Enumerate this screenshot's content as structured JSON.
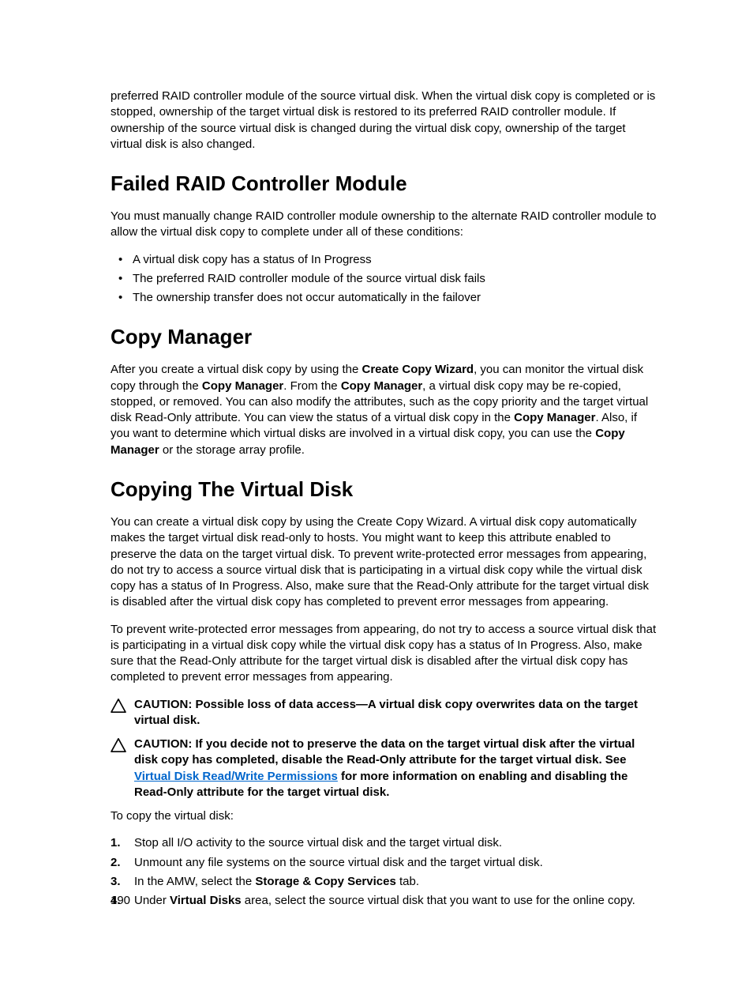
{
  "intro_para": "preferred RAID controller module of the source virtual disk. When the virtual disk copy is completed or is stopped, ownership of the target virtual disk is restored to its preferred RAID controller module. If ownership of the source virtual disk is changed during the virtual disk copy, ownership of the target virtual disk is also changed.",
  "section1": {
    "title": "Failed RAID Controller Module",
    "para": "You must manually change RAID controller module ownership to the alternate RAID controller module to allow the virtual disk copy to complete under all of these conditions:",
    "bullets": [
      "A virtual disk copy has a status of In Progress",
      "The preferred RAID controller module of the source virtual disk fails",
      "The ownership transfer does not occur automatically in the failover"
    ]
  },
  "section2": {
    "title": "Copy Manager",
    "para_parts": {
      "t0": "After you create a virtual disk copy by using the ",
      "b0": "Create Copy Wizard",
      "t1": ", you can monitor the virtual disk copy through the ",
      "b1": "Copy Manager",
      "t2": ". From the ",
      "b2": "Copy Manager",
      "t3": ", a virtual disk copy may be re-copied, stopped, or removed. You can also modify the attributes, such as the copy priority and the target virtual disk Read-Only attribute. You can view the status of a virtual disk copy in the ",
      "b3": "Copy Manager",
      "t4": ". Also, if you want to determine which virtual disks are involved in a virtual disk copy, you can use the ",
      "b4": "Copy Manager",
      "t5": " or the storage array profile."
    }
  },
  "section3": {
    "title": "Copying The Virtual Disk",
    "para1": "You can create a virtual disk copy by using the Create Copy Wizard. A virtual disk copy automatically makes the target virtual disk read-only to hosts. You might want to keep this attribute enabled to preserve the data on the target virtual disk. To prevent write-protected error messages from appearing, do not try to access a source virtual disk that is participating in a virtual disk copy while the virtual disk copy has a status of In Progress. Also, make sure that the Read-Only attribute for the target virtual disk is disabled after the virtual disk copy has completed to prevent error messages from appearing.",
    "para2": "To prevent write-protected error messages from appearing, do not try to access a source virtual disk that is participating in a virtual disk copy while the virtual disk copy has a status of In Progress. Also, make sure that the Read-Only attribute for the target virtual disk is disabled after the virtual disk copy has completed to prevent error messages from appearing.",
    "caution1": "CAUTION: Possible loss of data access—A virtual disk copy overwrites data on the target virtual disk.",
    "caution2_parts": {
      "t0": "CAUTION: If you decide not to preserve the data on the target virtual disk after the virtual disk copy has completed, disable the Read-Only attribute for the target virtual disk. See ",
      "link": "Virtual Disk Read/Write Permissions",
      "t1": " for more information on enabling and disabling the Read-Only attribute for the target virtual disk."
    },
    "para3": "To copy the virtual disk:",
    "steps": [
      {
        "t0": "Stop all I/O activity to the source virtual disk and the target virtual disk."
      },
      {
        "t0": "Unmount any file systems on the source virtual disk and the target virtual disk."
      },
      {
        "t0": "In the AMW, select the ",
        "b0": "Storage & Copy Services",
        "t1": " tab."
      },
      {
        "t0": "Under ",
        "b0": "Virtual Disks",
        "t1": " area, select the source virtual disk that you want to use for the online copy."
      }
    ]
  },
  "page_number": "190"
}
